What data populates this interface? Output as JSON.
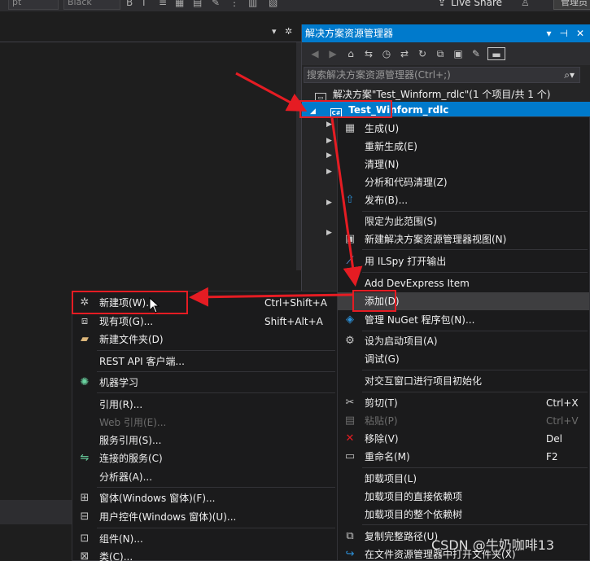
{
  "toolbar": {
    "font_size_value": "pt",
    "theme_value": "Black",
    "live_share_label": "Live Share",
    "admin_label": "管理员"
  },
  "solution_explorer": {
    "title": "解决方案资源管理器",
    "title_ctrl_dropdown": "▾",
    "title_ctrl_pin": "⊣",
    "title_ctrl_close": "✕",
    "search_placeholder": "搜索解决方案资源管理器(Ctrl+;)",
    "solution_label": "解决方案\"Test_Winform_rdlc\"(1 个项目/共 1 个)",
    "project_label": "Test_Winform_rdlc"
  },
  "project_menu": {
    "items": [
      {
        "label": "生成(U)",
        "icon": "build-icon",
        "shortcut": "",
        "disabled": false
      },
      {
        "label": "重新生成(E)",
        "icon": "",
        "shortcut": "",
        "disabled": false
      },
      {
        "label": "清理(N)",
        "icon": "",
        "shortcut": "",
        "disabled": false
      },
      {
        "label": "分析和代码清理(Z)",
        "icon": "",
        "shortcut": "",
        "disabled": false
      },
      {
        "label": "发布(B)...",
        "icon": "publish-icon",
        "shortcut": "",
        "disabled": false
      },
      {
        "label": "限定为此范围(S)",
        "icon": "",
        "shortcut": "",
        "disabled": false
      },
      {
        "label": "新建解决方案资源管理器视图(N)",
        "icon": "new-view-icon",
        "shortcut": "",
        "disabled": false
      },
      {
        "label": "用 ILSpy 打开输出",
        "icon": "ilspy-icon",
        "shortcut": "",
        "disabled": false
      },
      {
        "label": "Add DevExpress Item",
        "icon": "",
        "shortcut": "",
        "disabled": false
      },
      {
        "label": "添加(D)",
        "icon": "",
        "shortcut": "",
        "disabled": false
      },
      {
        "label": "管理 NuGet 程序包(N)...",
        "icon": "nuget-icon",
        "shortcut": "",
        "disabled": false
      },
      {
        "label": "设为启动项目(A)",
        "icon": "gear-icon",
        "shortcut": "",
        "disabled": false
      },
      {
        "label": "调试(G)",
        "icon": "",
        "shortcut": "",
        "disabled": false
      },
      {
        "label": "对交互窗口进行项目初始化",
        "icon": "",
        "shortcut": "",
        "disabled": false
      },
      {
        "label": "剪切(T)",
        "icon": "scissors-icon",
        "shortcut": "Ctrl+X",
        "disabled": false
      },
      {
        "label": "粘贴(P)",
        "icon": "paste-icon",
        "shortcut": "Ctrl+V",
        "disabled": true
      },
      {
        "label": "移除(V)",
        "icon": "remove-icon",
        "shortcut": "Del",
        "disabled": false
      },
      {
        "label": "重命名(M)",
        "icon": "rename-icon",
        "shortcut": "F2",
        "disabled": false
      },
      {
        "label": "卸载项目(L)",
        "icon": "",
        "shortcut": "",
        "disabled": false
      },
      {
        "label": "加载项目的直接依赖项",
        "icon": "",
        "shortcut": "",
        "disabled": false
      },
      {
        "label": "加载项目的整个依赖树",
        "icon": "",
        "shortcut": "",
        "disabled": false
      },
      {
        "label": "复制完整路径(U)",
        "icon": "copy-path-icon",
        "shortcut": "",
        "disabled": false
      },
      {
        "label": "在文件资源管理器中打开文件夹(X)",
        "icon": "open-folder-icon",
        "shortcut": "",
        "disabled": false
      }
    ]
  },
  "add_submenu": {
    "items": [
      {
        "label": "新建项(W)...",
        "icon": "new-item-icon",
        "shortcut": "Ctrl+Shift+A",
        "disabled": false
      },
      {
        "label": "现有项(G)...",
        "icon": "existing-item-icon",
        "shortcut": "Shift+Alt+A",
        "disabled": false
      },
      {
        "label": "新建文件夹(D)",
        "icon": "new-folder-icon",
        "shortcut": "",
        "disabled": false
      },
      {
        "label": "REST API 客户端...",
        "icon": "",
        "shortcut": "",
        "disabled": false
      },
      {
        "label": "机器学习",
        "icon": "ml-icon",
        "shortcut": "",
        "disabled": false
      },
      {
        "label": "引用(R)...",
        "icon": "",
        "shortcut": "",
        "disabled": false
      },
      {
        "label": "Web 引用(E)...",
        "icon": "",
        "shortcut": "",
        "disabled": true
      },
      {
        "label": "服务引用(S)...",
        "icon": "",
        "shortcut": "",
        "disabled": false
      },
      {
        "label": "连接的服务(C)",
        "icon": "connected-service-icon",
        "shortcut": "",
        "disabled": false
      },
      {
        "label": "分析器(A)...",
        "icon": "",
        "shortcut": "",
        "disabled": false
      },
      {
        "label": "窗体(Windows 窗体)(F)...",
        "icon": "form-icon",
        "shortcut": "",
        "disabled": false
      },
      {
        "label": "用户控件(Windows 窗体)(U)...",
        "icon": "user-control-icon",
        "shortcut": "",
        "disabled": false
      },
      {
        "label": "组件(N)...",
        "icon": "component-icon",
        "shortcut": "",
        "disabled": false
      },
      {
        "label": "类(C)...",
        "icon": "class-icon",
        "shortcut": "",
        "disabled": false
      }
    ]
  },
  "watermark": "CSDN @牛奶咖啡13",
  "colors": {
    "accent": "#007acc",
    "annotation": "#e51c23",
    "menu_bg": "#1b1b1c"
  }
}
